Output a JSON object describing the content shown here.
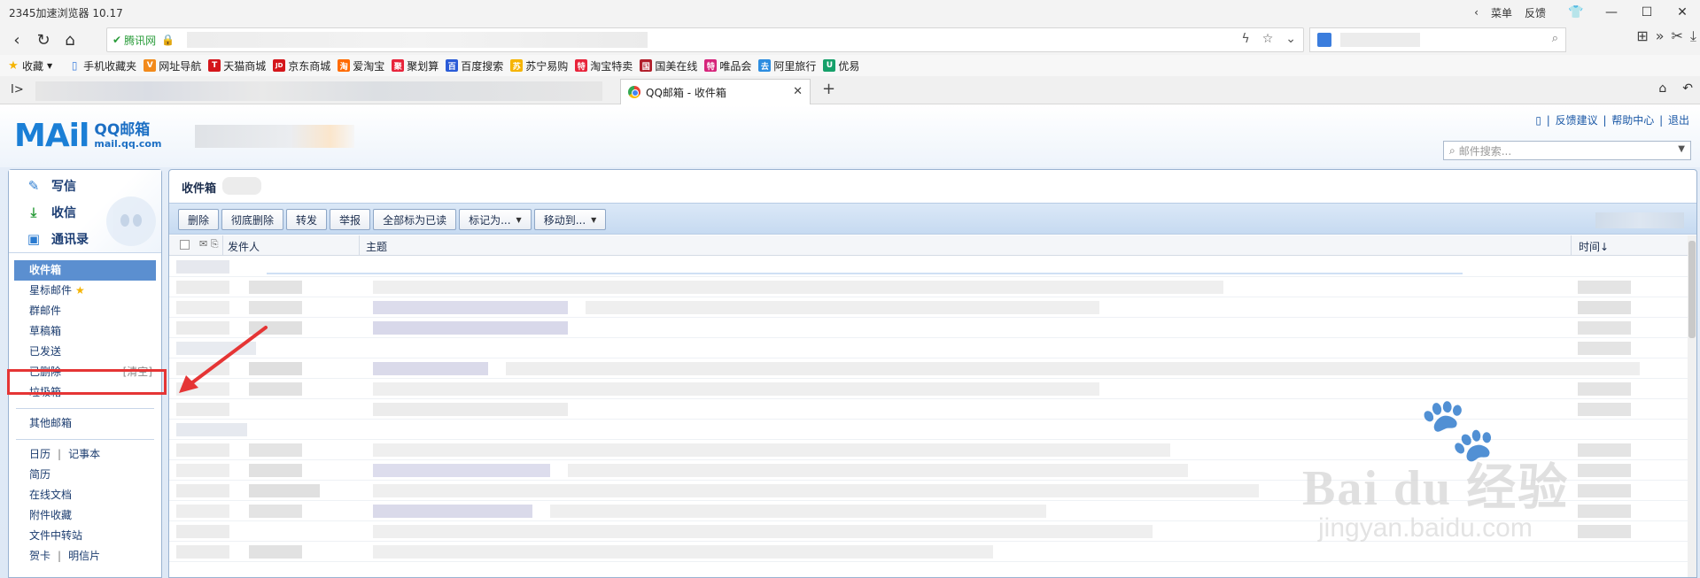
{
  "browser": {
    "title": "2345加速浏览器 10.17",
    "menu_label": "菜单",
    "feedback_label": "反馈",
    "site_badge": "腾讯网",
    "bookmarks": [
      {
        "label": "收藏",
        "color": "#f5b400",
        "glyph": "★"
      },
      {
        "label": "手机收藏夹",
        "color": "#3b7ddd",
        "glyph": "▯"
      },
      {
        "label": "网址导航",
        "color": "#f28a1b",
        "glyph": "V"
      },
      {
        "label": "天猫商城",
        "color": "#d4161b",
        "glyph": "T"
      },
      {
        "label": "京东商城",
        "color": "#d4161b",
        "glyph": "JD"
      },
      {
        "label": "爱淘宝",
        "color": "#ff6a00",
        "glyph": "淘"
      },
      {
        "label": "聚划算",
        "color": "#e8233a",
        "glyph": "聚"
      },
      {
        "label": "百度搜索",
        "color": "#2a5bd7",
        "glyph": "百"
      },
      {
        "label": "苏宁易购",
        "color": "#f6b400",
        "glyph": "苏"
      },
      {
        "label": "淘宝特卖",
        "color": "#e8233a",
        "glyph": "特"
      },
      {
        "label": "国美在线",
        "color": "#b11e2a",
        "glyph": "国"
      },
      {
        "label": "唯品会",
        "color": "#d6257b",
        "glyph": "特"
      },
      {
        "label": "阿里旅行",
        "color": "#2d8de0",
        "glyph": "去"
      },
      {
        "label": "优易",
        "color": "#16a06a",
        "glyph": "U"
      }
    ],
    "active_tab": "QQ邮箱 - 收件箱",
    "search_placeholder": ""
  },
  "mail": {
    "logo_main": "MAil",
    "logo_title": "QQ邮箱",
    "logo_domain": "mail.qq.com",
    "top_links": [
      "反馈建议",
      "帮助中心",
      "退出"
    ],
    "search_placeholder": "邮件搜索...",
    "quick": {
      "compose": "写信",
      "receive": "收信",
      "contacts": "通讯录"
    },
    "folders": {
      "inbox": "收件箱",
      "starred": "星标邮件",
      "group": "群邮件",
      "drafts": "草稿箱",
      "sent": "已发送",
      "deleted": "已删除",
      "deleted_clear": "[清空]",
      "spam": "垃圾箱",
      "other": "其他邮箱",
      "calendar": "日历",
      "notes": "记事本",
      "resume": "简历",
      "docs": "在线文档",
      "attachments": "附件收藏",
      "transfer": "文件中转站",
      "cards": "贺卡",
      "postcards": "明信片"
    },
    "main_title": "收件箱",
    "toolbar": {
      "delete": "删除",
      "delete_permanently": "彻底删除",
      "forward": "转发",
      "report": "举报",
      "mark_all_read": "全部标为已读",
      "mark_as": "标记为...",
      "move_to": "移动到..."
    },
    "columns": {
      "sender": "发件人",
      "subject": "主题",
      "time": "时间↓"
    }
  },
  "watermark": {
    "line1": "Bai du 经验",
    "line2": "jingyan.baidu.com"
  }
}
